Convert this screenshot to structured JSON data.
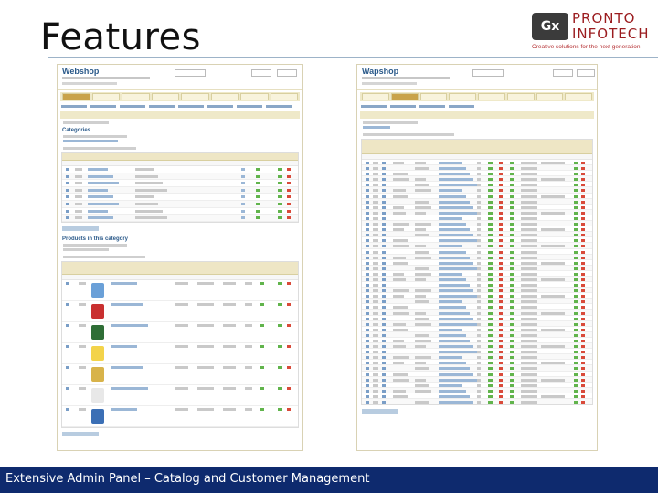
{
  "slide": {
    "title": "Features",
    "caption": "Extensive Admin Panel – Catalog and Customer Management"
  },
  "logo": {
    "badge": "Gx",
    "name_line1": "PRONTO",
    "name_line2": "INFOTECH",
    "tagline": "Creative solutions for the next generation"
  },
  "screenshots": {
    "left": {
      "brand": "Webshop",
      "panel_categories": "Categories",
      "panel_products": "Products in this category",
      "category_rows": 8,
      "product_thumb_colors": [
        "#6aa0d8",
        "#c93030",
        "#2f6e36",
        "#f3d34a",
        "#d8b34a",
        "#e8e8e8",
        "#3b6fb5"
      ]
    },
    "right": {
      "brand": "Wapshop",
      "customer_rows": 44
    }
  },
  "colors": {
    "caption_bar": "#0e2a6e",
    "logo_red": "#9b1c1f",
    "title_rule": "#9db3c8"
  }
}
